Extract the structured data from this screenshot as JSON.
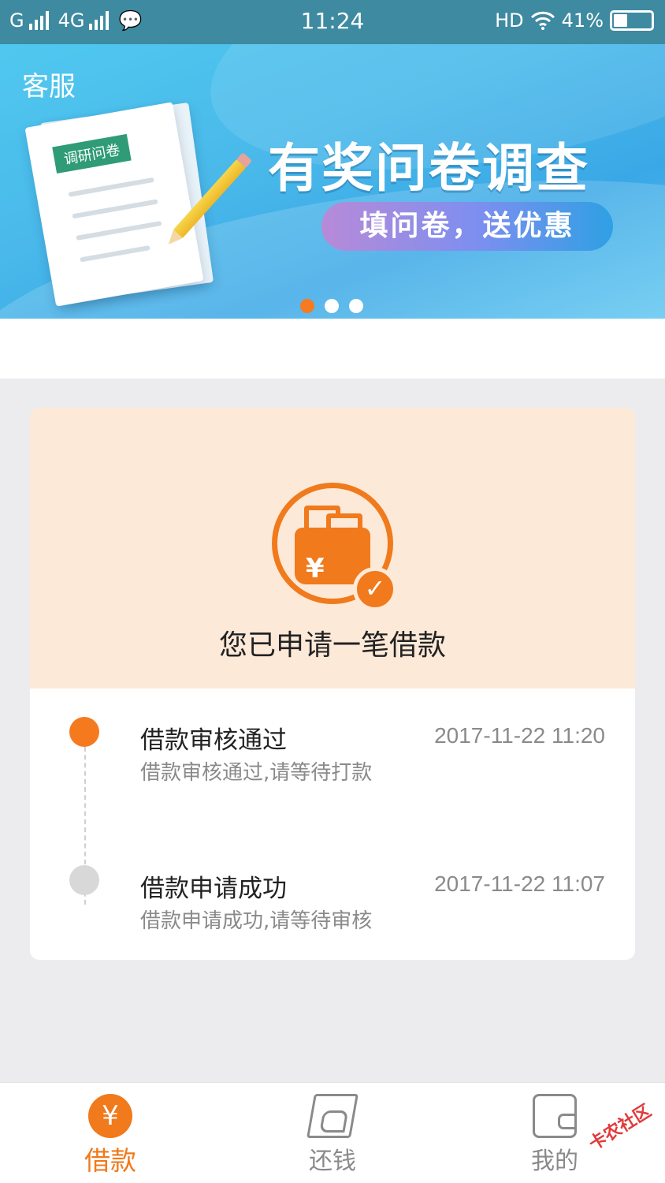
{
  "status_bar": {
    "carrier1": "G",
    "carrier2": "4G",
    "time": "11:24",
    "hd": "HD",
    "battery": "41%",
    "battery_level": 0.41,
    "icons": [
      "signal-icon",
      "message-icon",
      "wifi-icon",
      "battery-icon"
    ]
  },
  "header": {
    "service_label": "客服"
  },
  "banner": {
    "paper_tag": "调研问卷",
    "title": "有奖问卷调查",
    "subtitle": "填问卷，送优惠",
    "dots": 3,
    "active_dot": 0,
    "colors": {
      "accent": "#f57a20",
      "sky": "#4ab9ea"
    }
  },
  "status_card": {
    "icon": "wallet-yen-check-icon",
    "title": "您已申请一笔借款",
    "events": [
      {
        "title": "借款审核通过",
        "desc": "借款审核通过,请等待打款",
        "time": "2017-11-22 11:20",
        "state": "active"
      },
      {
        "title": "借款申请成功",
        "desc": "借款申请成功,请等待审核",
        "time": "2017-11-22 11:07",
        "state": "done"
      }
    ],
    "colors": {
      "top_bg": "#fde9d8",
      "accent": "#f07a1c"
    }
  },
  "tabbar": {
    "tabs": [
      {
        "label": "借款",
        "icon": "yen-icon",
        "active": true,
        "glyph": "¥"
      },
      {
        "label": "还钱",
        "icon": "repay-icon",
        "active": false
      },
      {
        "label": "我的",
        "icon": "wallet-icon",
        "active": false
      }
    ]
  },
  "watermark": "卡农社区"
}
